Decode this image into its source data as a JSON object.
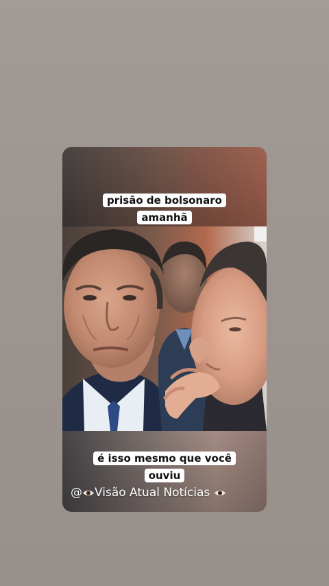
{
  "story": {
    "caption_top": "prisão de bolsonaro amanhã",
    "caption_top_line1": "prisão de bolsonaro",
    "caption_top_line2": "amanhã",
    "caption_bottom_line1": "é isso mesmo que você",
    "caption_bottom_line2": "ouviu",
    "watermark_at": "@",
    "watermark_text": "Visão Atual Notícias ",
    "watermark_icon": "eye-icon",
    "photo_description_icon": "photo"
  },
  "colors": {
    "background": "#9a918a",
    "caption_bg": "#ffffff",
    "caption_text": "#111111",
    "watermark_text": "#ffffff"
  }
}
